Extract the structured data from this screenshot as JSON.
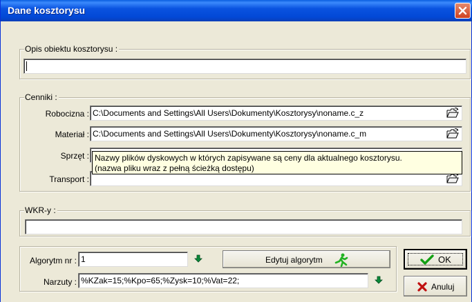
{
  "window": {
    "title": "Dane kosztorysu"
  },
  "opis": {
    "legend": "Opis obiektu kosztorysu :",
    "value": ""
  },
  "cenniki": {
    "legend": "Cenniki :",
    "robocizna_label": "Robocizna :",
    "robocizna_value": "C:\\Documents and Settings\\All Users\\Dokumenty\\Kosztorysy\\noname.c_z",
    "material_label": "Materiał :",
    "material_value": "C:\\Documents and Settings\\All Users\\Dokumenty\\Kosztorysy\\noname.c_m",
    "sprzet_label": "Sprzęt :",
    "sprzet_value": "",
    "transport_label": "Transport :",
    "transport_value": ""
  },
  "tooltip": {
    "line1": "Nazwy plików dyskowych w których zapisywane są ceny dla aktualnego kosztorysu.",
    "line2": "(nazwa pliku wraz z pełną ścieżką dostępu)"
  },
  "wkr": {
    "legend": "WKR-y :",
    "value": ""
  },
  "algorytm": {
    "label": "Algorytm nr :",
    "value": "1",
    "edit_label": "Edytuj algorytm",
    "narzuty_label": "Narzuty :",
    "narzuty_value": "%KZak=15;%Kpo=65;%Zysk=10;%Vat=22;"
  },
  "buttons": {
    "ok": "OK",
    "cancel": "Anuluj"
  },
  "icons": {
    "browse": "open-folder-icon",
    "arrow": "green-down-arrow-icon",
    "edit": "running-man-icon",
    "ok": "green-checkmark-icon",
    "cancel": "red-x-icon",
    "close": "close-icon"
  },
  "colors": {
    "titlebar": "#0a53e0",
    "face": "#ece9d8",
    "tooltip": "#ffffe1",
    "close": "#d0411f"
  }
}
